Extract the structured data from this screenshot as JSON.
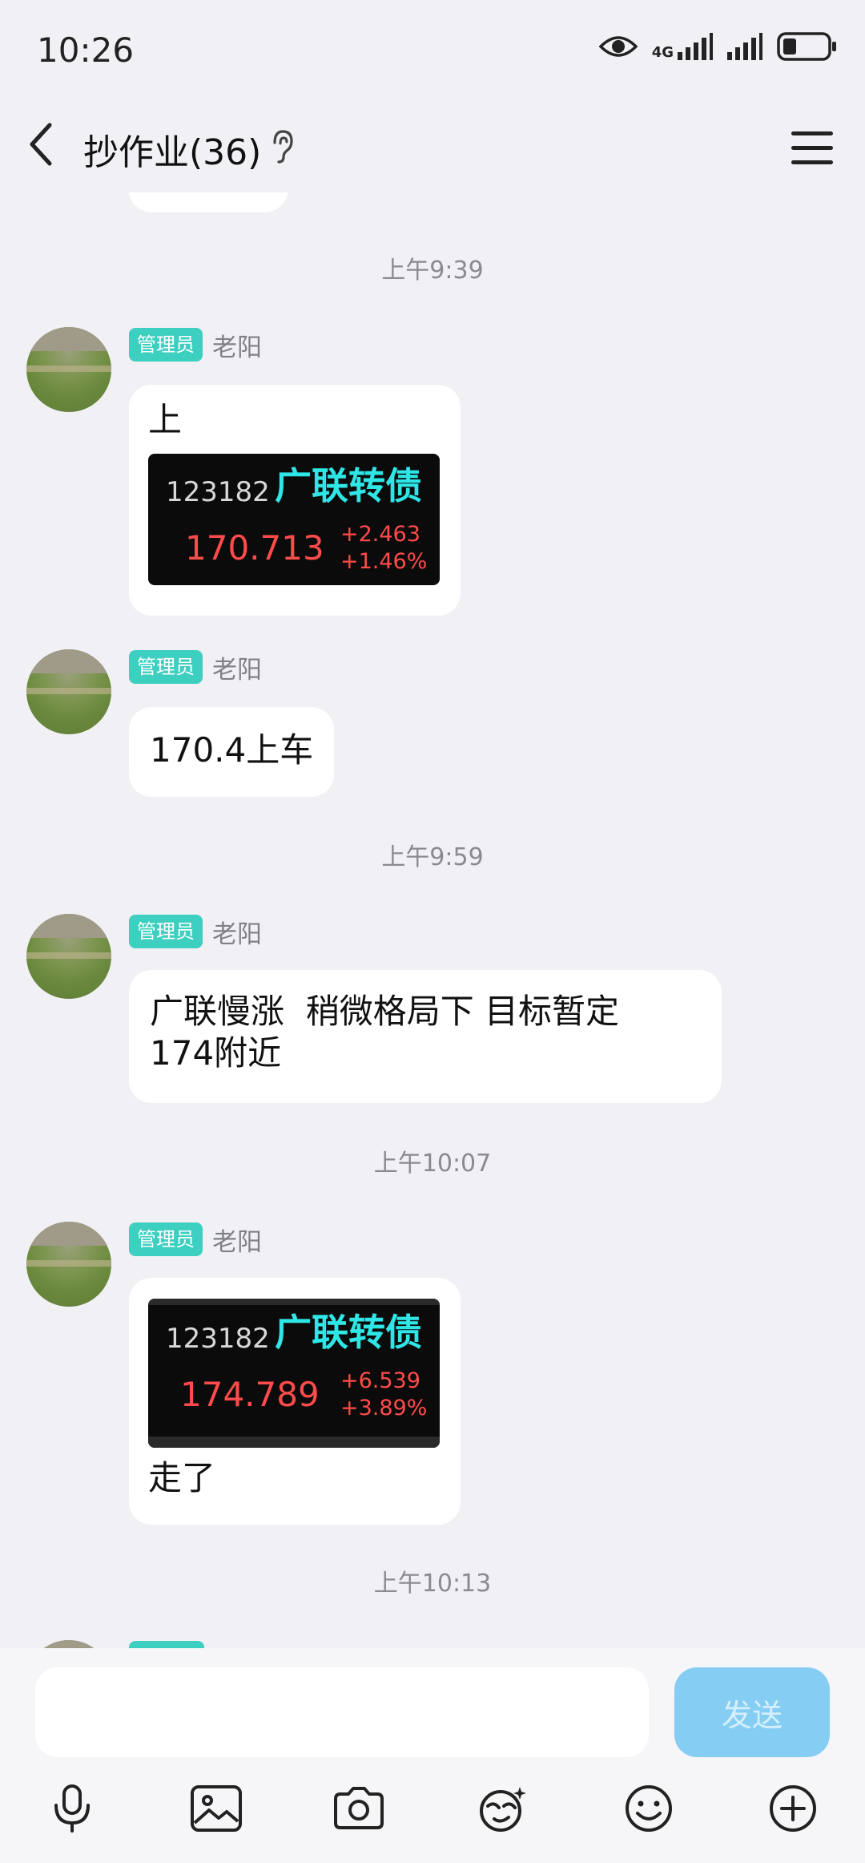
{
  "status_bar": {
    "time": "10:26",
    "network_label": "4G"
  },
  "header": {
    "title": "抄作业(36)"
  },
  "messages": [
    {
      "time": "上午9:39",
      "badge": "管理员",
      "sender": "老阳",
      "text": "上",
      "stock": {
        "code": "123182",
        "name": "广联转债",
        "price": "170.713",
        "change": "+2.463",
        "percent": "+1.46%"
      }
    },
    {
      "badge": "管理员",
      "sender": "老阳",
      "text": "170.4上车"
    },
    {
      "time": "上午9:59",
      "badge": "管理员",
      "sender": "老阳",
      "text_line1": "广联慢涨  稍微格局下 目标暂定",
      "text_line2": "174附近"
    },
    {
      "time": "上午10:07",
      "badge": "管理员",
      "sender": "老阳",
      "stock": {
        "code": "123182",
        "name": "广联转债",
        "price": "174.789",
        "change": "+6.539",
        "percent": "+3.89%"
      },
      "text": "走了"
    },
    {
      "time": "上午10:13"
    }
  ],
  "input": {
    "placeholder": "",
    "send_label": "发送"
  },
  "toolbar": [
    "microphone-icon",
    "image-icon",
    "camera-icon",
    "sticker-icon",
    "emoji-icon",
    "plus-icon"
  ],
  "colors": {
    "badge": "#3dcfc0",
    "send": "#86cdf4",
    "stock_up": "#ff4b4b",
    "stock_name": "#2ee6e6"
  }
}
